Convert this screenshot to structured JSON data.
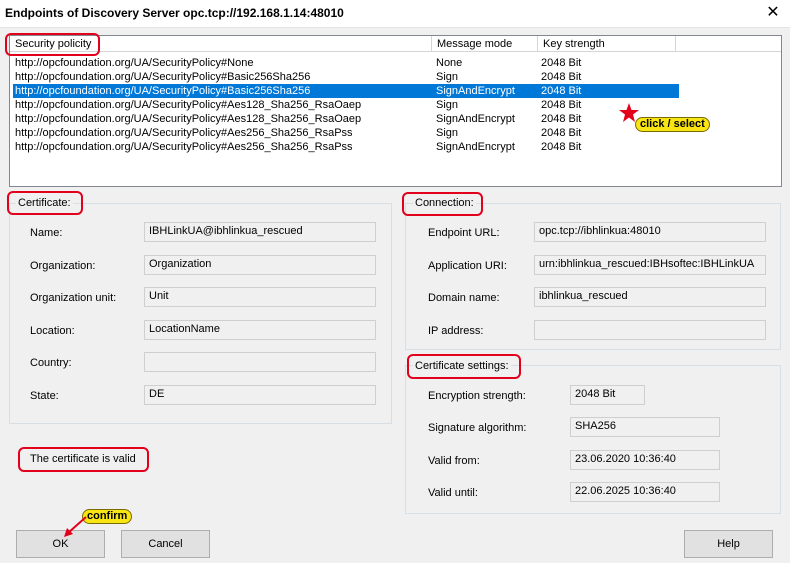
{
  "title": "Endpoints of Discovery Server opc.tcp://192.168.1.14:48010",
  "endpoints": {
    "headers": [
      "Security policity",
      "Message mode",
      "Key strength"
    ],
    "rows": [
      {
        "policy": "http://opcfoundation.org/UA/SecurityPolicy#None",
        "mode": "None",
        "key": "2048 Bit"
      },
      {
        "policy": "http://opcfoundation.org/UA/SecurityPolicy#Basic256Sha256",
        "mode": "Sign",
        "key": "2048 Bit"
      },
      {
        "policy": "http://opcfoundation.org/UA/SecurityPolicy#Basic256Sha256",
        "mode": "SignAndEncrypt",
        "key": "2048 Bit"
      },
      {
        "policy": "http://opcfoundation.org/UA/SecurityPolicy#Aes128_Sha256_RsaOaep",
        "mode": "Sign",
        "key": "2048 Bit"
      },
      {
        "policy": "http://opcfoundation.org/UA/SecurityPolicy#Aes128_Sha256_RsaOaep",
        "mode": "SignAndEncrypt",
        "key": "2048 Bit"
      },
      {
        "policy": "http://opcfoundation.org/UA/SecurityPolicy#Aes256_Sha256_RsaPss",
        "mode": "Sign",
        "key": "2048 Bit"
      },
      {
        "policy": "http://opcfoundation.org/UA/SecurityPolicy#Aes256_Sha256_RsaPss",
        "mode": "SignAndEncrypt",
        "key": "2048 Bit"
      }
    ],
    "selected_index": 2
  },
  "certificate": {
    "legend": "Certificate:",
    "name_label": "Name:",
    "name": "IBHLinkUA@ibhlinkua_rescued",
    "org_label": "Organization:",
    "org": "Organization",
    "unit_label": "Organization unit:",
    "unit": "Unit",
    "location_label": "Location:",
    "location": "LocationName",
    "country_label": "Country:",
    "country": "",
    "state_label": "State:",
    "state": "DE"
  },
  "connection": {
    "legend": "Connection:",
    "url_label": "Endpoint URL:",
    "url": "opc.tcp://ibhlinkua:48010",
    "uri_label": "Application URI:",
    "uri": "urn:ibhlinkua_rescued:IBHsoftec:IBHLinkUA",
    "domain_label": "Domain name:",
    "domain": "ibhlinkua_rescued",
    "ip_label": "IP address:",
    "ip": ""
  },
  "cert_settings": {
    "legend": "Certificate settings:",
    "strength_label": "Encryption strength:",
    "strength": "2048 Bit",
    "sig_label": "Signature algorithm:",
    "sig": "SHA256",
    "from_label": "Valid from:",
    "from": "23.06.2020 10:36:40",
    "until_label": "Valid until:",
    "until": "22.06.2025 10:36:40"
  },
  "status": "The certificate is valid",
  "buttons": {
    "ok": "OK",
    "cancel": "Cancel",
    "help": "Help"
  },
  "annotations": {
    "click_select": "click / select",
    "confirm": "confirm"
  },
  "colors": {
    "selection": "#0078d7",
    "highlight": "#e3001b",
    "callout": "#f8e513"
  }
}
